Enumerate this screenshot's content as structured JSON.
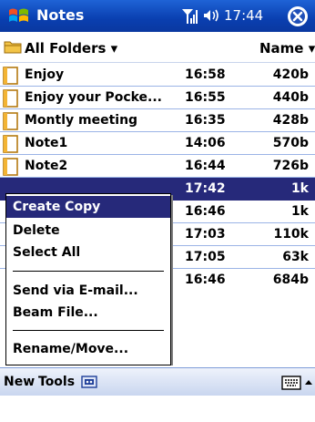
{
  "titlebar": {
    "app_title": "Notes",
    "time": "17:44"
  },
  "folderbar": {
    "folder": "All Folders",
    "sort": "Name"
  },
  "notes": [
    {
      "name": "Enjoy",
      "time": "16:58",
      "size": "420b"
    },
    {
      "name": "Enjoy your Pocke...",
      "time": "16:55",
      "size": "440b"
    },
    {
      "name": "Montly meeting",
      "time": "16:35",
      "size": "428b"
    },
    {
      "name": "Note1",
      "time": "14:06",
      "size": "570b"
    },
    {
      "name": "Note2",
      "time": "16:44",
      "size": "726b"
    },
    {
      "name": "",
      "time": "17:42",
      "size": "1k"
    },
    {
      "name": "",
      "time": "16:46",
      "size": "1k"
    },
    {
      "name": "",
      "time": "17:03",
      "size": "110k"
    },
    {
      "name": "",
      "time": "17:05",
      "size": "63k"
    },
    {
      "name": "",
      "time": "16:46",
      "size": "684b"
    }
  ],
  "context_menu": {
    "create_copy": "Create Copy",
    "delete": "Delete",
    "select_all": "Select All",
    "send_email": "Send via E-mail...",
    "beam_file": "Beam File...",
    "rename_move": "Rename/Move..."
  },
  "toolbar": {
    "new": "New",
    "tools": "Tools"
  },
  "colors": {
    "title_blue": "#0a3fb0",
    "selection": "#26297a",
    "row_line": "#9bb4e6"
  },
  "icons": [
    "windows-start-icon",
    "signal-icon",
    "speaker-icon",
    "close-icon",
    "folder-icon",
    "note-icon",
    "keyboard-icon",
    "input-arrow-icon"
  ]
}
